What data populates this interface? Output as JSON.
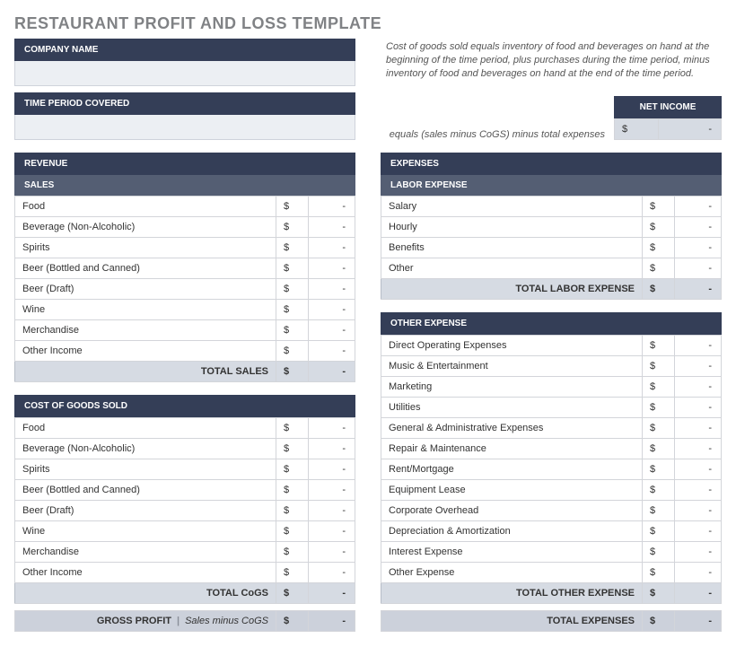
{
  "title": "RESTAURANT PROFIT AND LOSS TEMPLATE",
  "companyName": {
    "label": "COMPANY NAME"
  },
  "timePeriod": {
    "label": "TIME PERIOD COVERED"
  },
  "cogsNote": "Cost of goods sold equals inventory of food and beverages on hand at the beginning of the time period, plus purchases during the time period, minus inventory of food and beverages on hand at the end of the time period.",
  "netIncome": {
    "label": "NET INCOME",
    "note": "equals (sales minus CoGS) minus total expenses",
    "sym": "$",
    "val": "-"
  },
  "revenue": {
    "label": "REVENUE",
    "sales": {
      "label": "SALES",
      "rows": [
        {
          "label": "Food",
          "sym": "$",
          "val": "-"
        },
        {
          "label": "Beverage (Non-Alcoholic)",
          "sym": "$",
          "val": "-"
        },
        {
          "label": "Spirits",
          "sym": "$",
          "val": "-"
        },
        {
          "label": "Beer (Bottled and Canned)",
          "sym": "$",
          "val": "-"
        },
        {
          "label": "Beer (Draft)",
          "sym": "$",
          "val": "-"
        },
        {
          "label": "Wine",
          "sym": "$",
          "val": "-"
        },
        {
          "label": "Merchandise",
          "sym": "$",
          "val": "-"
        },
        {
          "label": "Other  Income",
          "sym": "$",
          "val": "-"
        }
      ],
      "total": {
        "label": "TOTAL SALES",
        "sym": "$",
        "val": "-"
      }
    }
  },
  "cogs": {
    "label": "COST OF GOODS SOLD",
    "rows": [
      {
        "label": "Food",
        "sym": "$",
        "val": "-"
      },
      {
        "label": "Beverage (Non-Alcoholic)",
        "sym": "$",
        "val": "-"
      },
      {
        "label": "Spirits",
        "sym": "$",
        "val": "-"
      },
      {
        "label": "Beer (Bottled and Canned)",
        "sym": "$",
        "val": "-"
      },
      {
        "label": "Beer (Draft)",
        "sym": "$",
        "val": "-"
      },
      {
        "label": "Wine",
        "sym": "$",
        "val": "-"
      },
      {
        "label": "Merchandise",
        "sym": "$",
        "val": "-"
      },
      {
        "label": "Other  Income",
        "sym": "$",
        "val": "-"
      }
    ],
    "total": {
      "label": "TOTAL CoGS",
      "sym": "$",
      "val": "-"
    }
  },
  "grossProfit": {
    "label": "GROSS PROFIT",
    "note": "Sales minus CoGS",
    "sym": "$",
    "val": "-",
    "sep": "|"
  },
  "expenses": {
    "label": "EXPENSES",
    "labor": {
      "label": "LABOR EXPENSE",
      "rows": [
        {
          "label": "Salary",
          "sym": "$",
          "val": "-"
        },
        {
          "label": "Hourly",
          "sym": "$",
          "val": "-"
        },
        {
          "label": "Benefits",
          "sym": "$",
          "val": "-"
        },
        {
          "label": "Other",
          "sym": "$",
          "val": "-"
        }
      ],
      "total": {
        "label": "TOTAL LABOR EXPENSE",
        "sym": "$",
        "val": "-"
      }
    },
    "other": {
      "label": "OTHER EXPENSE",
      "rows": [
        {
          "label": "Direct Operating Expenses",
          "sym": "$",
          "val": "-"
        },
        {
          "label": "Music & Entertainment",
          "sym": "$",
          "val": "-"
        },
        {
          "label": "Marketing",
          "sym": "$",
          "val": "-"
        },
        {
          "label": "Utilities",
          "sym": "$",
          "val": "-"
        },
        {
          "label": "General & Administrative Expenses",
          "sym": "$",
          "val": "-"
        },
        {
          "label": "Repair & Maintenance",
          "sym": "$",
          "val": "-"
        },
        {
          "label": "Rent/Mortgage",
          "sym": "$",
          "val": "-"
        },
        {
          "label": "Equipment Lease",
          "sym": "$",
          "val": "-"
        },
        {
          "label": "Corporate Overhead",
          "sym": "$",
          "val": "-"
        },
        {
          "label": "Depreciation & Amortization",
          "sym": "$",
          "val": "-"
        },
        {
          "label": "Interest Expense",
          "sym": "$",
          "val": "-"
        },
        {
          "label": "Other Expense",
          "sym": "$",
          "val": "-"
        }
      ],
      "total": {
        "label": "TOTAL OTHER EXPENSE",
        "sym": "$",
        "val": "-"
      }
    },
    "total": {
      "label": "TOTAL EXPENSES",
      "sym": "$",
      "val": "-"
    }
  }
}
